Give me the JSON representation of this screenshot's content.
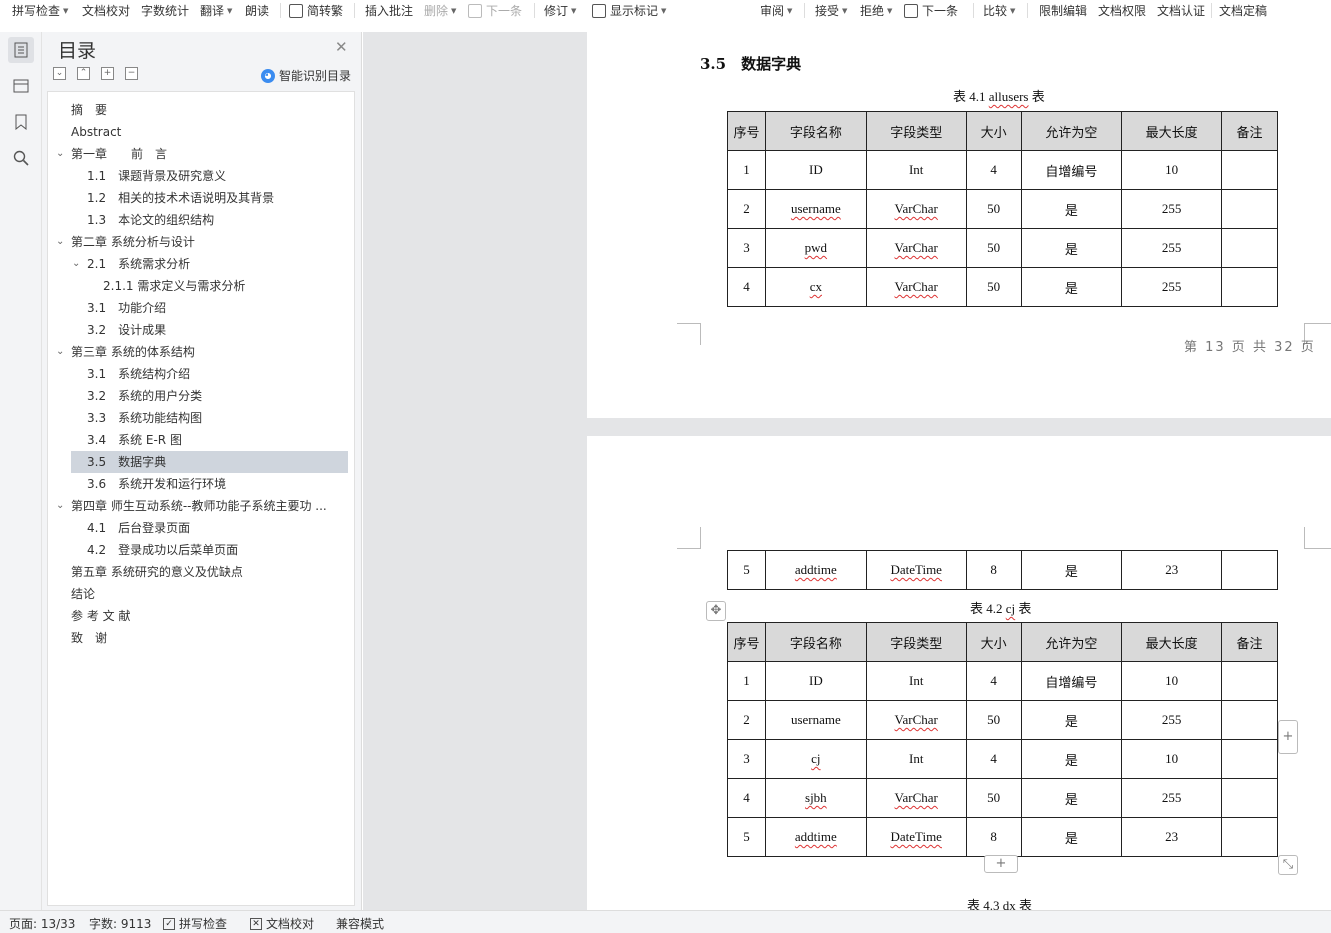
{
  "toolbar": {
    "items": [
      "拼写检查",
      "文档校对",
      "字数统计",
      "翻译",
      "朗读",
      "简转繁",
      "插入批注",
      "删除",
      "下一条",
      "修订",
      "显示标记",
      "审阅",
      "接受",
      "拒绝",
      "下一条",
      "比较",
      "限制编辑",
      "文档权限",
      "文档认证",
      "文档定稿"
    ]
  },
  "nav": {
    "title": "目录",
    "smart_label": "智能识别目录",
    "toc": [
      "摘　要",
      "Abstract",
      "第一章　　前　言",
      "1.1　课题背景及研究意义",
      "1.2　相关的技术术语说明及其背景",
      "1.3　本论文的组织结构",
      "第二章  系统分析与设计",
      "2.1　系统需求分析",
      "2.1.1 需求定义与需求分析",
      "3.1　功能介绍",
      "3.2　设计成果",
      "第三章  系统的体系结构",
      "3.1　系统结构介绍",
      "3.2　系统的用户分类",
      "3.3　系统功能结构图",
      "3.4　系统 E-R 图",
      "3.5　数据字典",
      "3.6　系统开发和运行环境",
      "第四章  师生互动系统--教师功能子系统主要功 ...",
      "4.1　后台登录页面",
      "4.2　登录成功以后菜单页面",
      "第五章  系统研究的意义及优缺点",
      "结论",
      "参 考 文 献",
      "致　谢"
    ]
  },
  "doc": {
    "section_heading": "3.5　数据字典",
    "table1": {
      "caption_prefix": "表 4.1 ",
      "caption_name": "allusers",
      "caption_suffix": " 表",
      "headers": [
        "序号",
        "字段名称",
        "字段类型",
        "大小",
        "允许为空",
        "最大长度",
        "备注"
      ],
      "rows": [
        [
          "1",
          "ID",
          "Int",
          "4",
          "自增编号",
          "10",
          ""
        ],
        [
          "2",
          "username",
          "VarChar",
          "50",
          "是",
          "255",
          ""
        ],
        [
          "3",
          "pwd",
          "VarChar",
          "50",
          "是",
          "255",
          ""
        ],
        [
          "4",
          "cx",
          "VarChar",
          "50",
          "是",
          "255",
          ""
        ]
      ],
      "continued_row": [
        "5",
        "addtime",
        "DateTime",
        "8",
        "是",
        "23",
        ""
      ]
    },
    "page_footer": "第 13 页 共 32 页",
    "table2": {
      "caption_prefix": "表 4.2 ",
      "caption_name": "cj",
      "caption_suffix": " 表",
      "headers": [
        "序号",
        "字段名称",
        "字段类型",
        "大小",
        "允许为空",
        "最大长度",
        "备注"
      ],
      "rows": [
        [
          "1",
          "ID",
          "Int",
          "4",
          "自增编号",
          "10",
          ""
        ],
        [
          "2",
          "username",
          "VarChar",
          "50",
          "是",
          "255",
          ""
        ],
        [
          "3",
          "cj",
          "Int",
          "4",
          "是",
          "10",
          ""
        ],
        [
          "4",
          "sjbh",
          "VarChar",
          "50",
          "是",
          "255",
          ""
        ],
        [
          "5",
          "addtime",
          "DateTime",
          "8",
          "是",
          "23",
          ""
        ]
      ]
    },
    "table3": {
      "caption_prefix": "表 4.3 ",
      "caption_name": "dx",
      "caption_suffix": " 表"
    }
  },
  "status": {
    "page": "页面: 13/33",
    "words": "字数: 9113",
    "spell": "拼写检查",
    "proof": "文档校对",
    "compat": "兼容模式"
  },
  "icons": [
    "toc-icon",
    "outline-icon",
    "bookmark-icon",
    "search-icon",
    "close-icon",
    "move-table-icon",
    "add-row-icon",
    "add-column-icon",
    "resize-table-icon"
  ]
}
